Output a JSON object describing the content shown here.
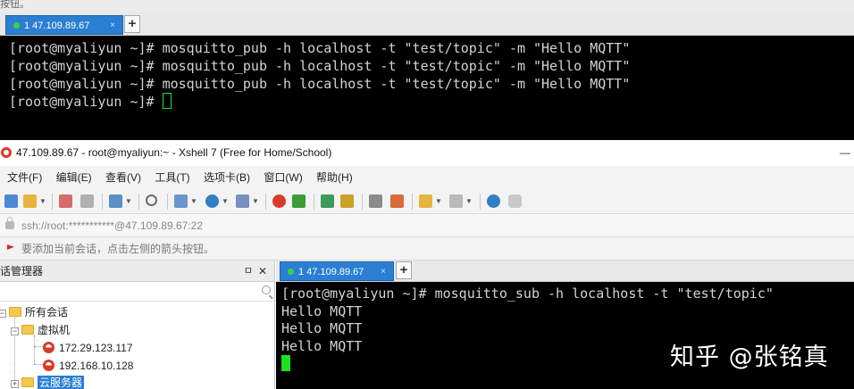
{
  "top_window": {
    "remnant_text": "按钮。",
    "tab": {
      "label": "1 47.109.89.67",
      "close": "×"
    },
    "new_tab": "+",
    "terminal_lines": [
      "[root@myaliyun ~]# mosquitto_pub -h localhost -t \"test/topic\" -m \"Hello MQTT\"",
      "[root@myaliyun ~]# mosquitto_pub -h localhost -t \"test/topic\" -m \"Hello MQTT\"",
      "[root@myaliyun ~]# mosquitto_pub -h localhost -t \"test/topic\" -m \"Hello MQTT\""
    ],
    "prompt": "[root@myaliyun ~]# "
  },
  "main_window": {
    "title": "47.109.89.67 - root@myaliyun:~ - Xshell 7 (Free for Home/School)",
    "minimize": "—",
    "menu": [
      "文件(F)",
      "编辑(E)",
      "查看(V)",
      "工具(T)",
      "选项卡(B)",
      "窗口(W)",
      "帮助(H)"
    ],
    "address": "ssh://root:***********@47.109.89.67:22",
    "hint": "要添加当前会话，点击左侧的箭头按钮。",
    "session_manager": {
      "title": "会话管理器",
      "pin": "ㅁ",
      "close": "✕",
      "tree": {
        "all_sessions": "所有会话",
        "vm_folder": "虚拟机",
        "vm_hosts": [
          "172.29.123.117",
          "192.168.10.128"
        ],
        "cloud_folder": "云服务器"
      }
    },
    "tab": {
      "label": "1 47.109.89.67",
      "close": "×"
    },
    "new_tab": "+",
    "terminal_lines": [
      "[root@myaliyun ~]# mosquitto_sub -h localhost -t \"test/topic\"",
      "Hello MQTT",
      "Hello MQTT",
      "Hello MQTT"
    ]
  },
  "watermark": "知乎 @张铭真",
  "colors": {
    "tab_active": "#2b7fd2",
    "cursor": "#1ee01e",
    "terminal_bg": "#000000"
  }
}
